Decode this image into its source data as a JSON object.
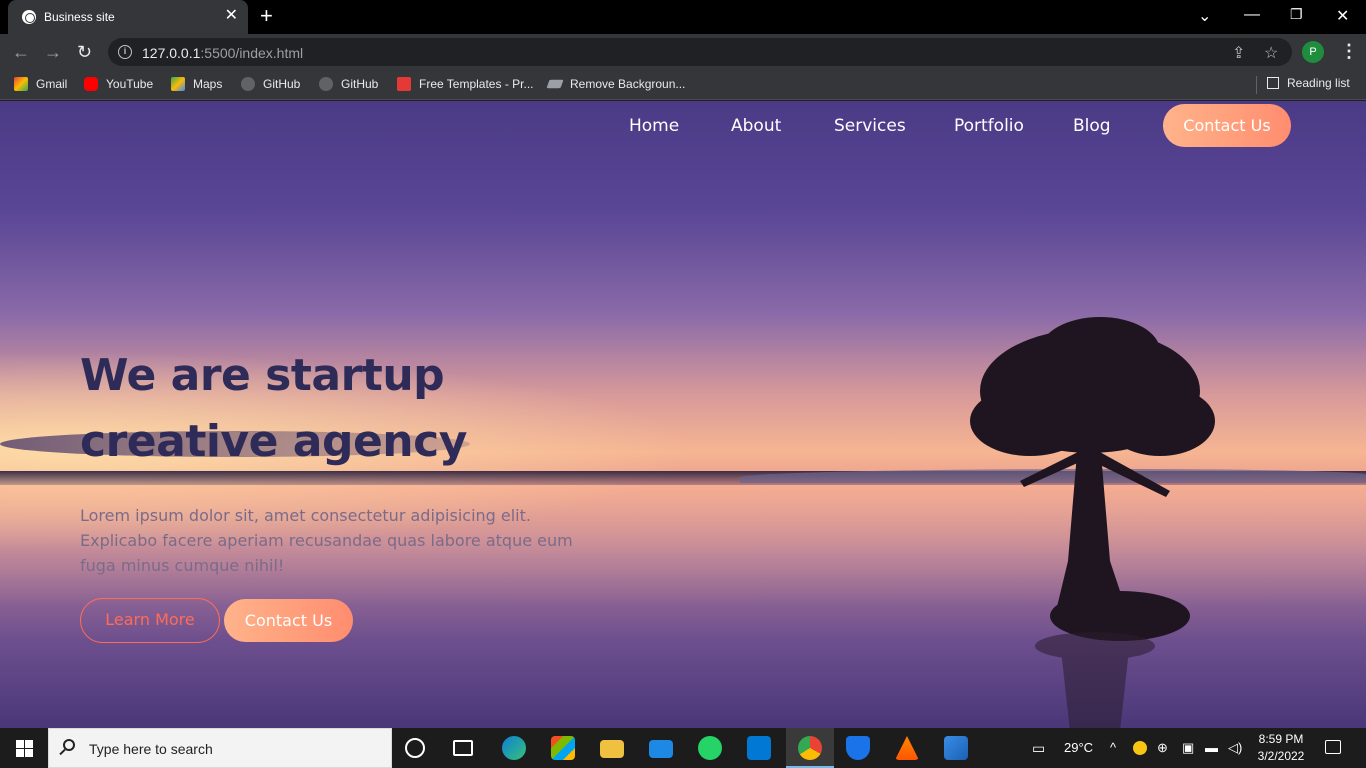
{
  "browser": {
    "tab_title": "Business site",
    "url_host": "127.0.0.1",
    "url_rest": ":5500/index.html",
    "profile_initial": "P",
    "bookmarks": [
      "Gmail",
      "YouTube",
      "Maps",
      "GitHub",
      "GitHub",
      "Free Templates - Pr...",
      "Remove Backgroun..."
    ],
    "reading_list": "Reading list"
  },
  "nav": {
    "links": [
      "Home",
      "About",
      "Services",
      "Portfolio",
      "Blog"
    ],
    "cta": "Contact Us"
  },
  "hero": {
    "title": "We are startup creative agency",
    "text": "Lorem ipsum dolor sit, amet consectetur adipisicing elit. Explicabo facere aperiam recusandae quas labore atque eum fuga minus cumque nihil!",
    "btn_secondary": "Learn More",
    "btn_primary": "Contact Us"
  },
  "taskbar": {
    "search_placeholder": "Type here to search",
    "weather": "29°C",
    "time": "8:59 PM",
    "date": "3/2/2022"
  },
  "colors": {
    "accent": "#ff8d6f",
    "title": "#2f2b58"
  }
}
